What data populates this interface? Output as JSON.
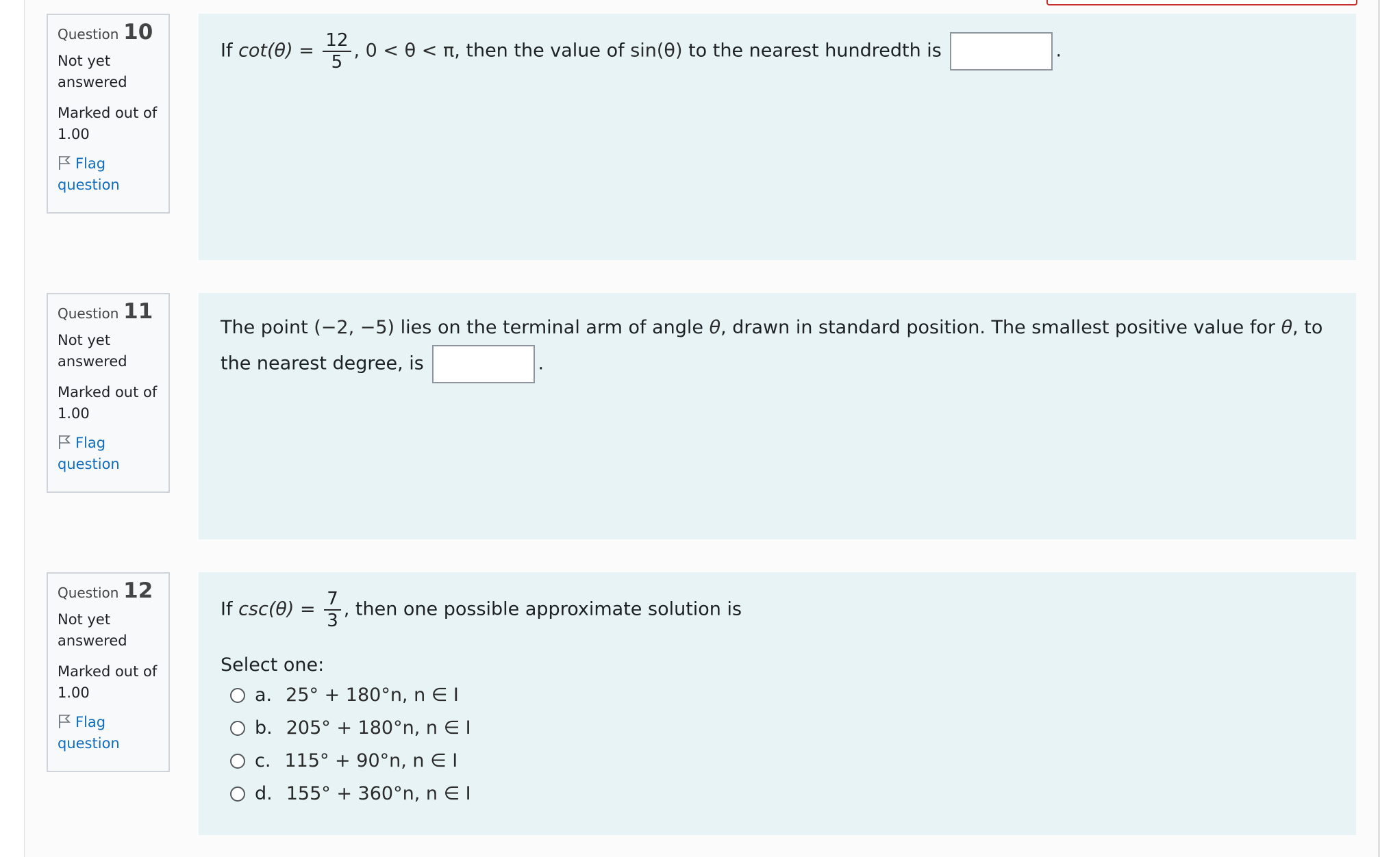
{
  "questions": [
    {
      "label": "Question",
      "number": "10",
      "state": "Not yet answered",
      "grade": "Marked out of 1.00",
      "flag_label": "Flag question",
      "prompt": {
        "prefix": "If ",
        "func": "cot(θ)",
        "eq": " = ",
        "frac_num": "12",
        "frac_den": "5",
        "after_frac": ", 0 < θ < π",
        "text_mid": ", then the value of ",
        "expr": "sin(θ)",
        "text_end": " to the nearest hundredth is",
        "trail": "."
      }
    },
    {
      "label": "Question",
      "number": "11",
      "state": "Not yet answered",
      "grade": "Marked out of 1.00",
      "flag_label": "Flag question",
      "prompt": {
        "text_a": "The point ",
        "point": "(−2, −5)",
        "text_b": " lies on the terminal arm of angle ",
        "theta": "θ",
        "text_c": ", drawn in standard position. The smallest positive value for ",
        "theta2": "θ",
        "text_d": ", to the nearest degree, is",
        "trail": "."
      }
    },
    {
      "label": "Question",
      "number": "12",
      "state": "Not yet answered",
      "grade": "Marked out of 1.00",
      "flag_label": "Flag question",
      "prompt": {
        "prefix": "If ",
        "func": "csc(θ)",
        "eq": " = ",
        "frac_num": "7",
        "frac_den": "3",
        "text_end": ", then one possible approximate solution is"
      },
      "select_label": "Select one:",
      "options": [
        {
          "letter": "a.",
          "text": "25° + 180°n, n ∈ I"
        },
        {
          "letter": "b.",
          "text": "205° + 180°n, n ∈ I"
        },
        {
          "letter": "c.",
          "text": "115° + 90°n, n ∈ I"
        },
        {
          "letter": "d.",
          "text": "155° + 360°n, n ∈ I"
        }
      ]
    }
  ]
}
